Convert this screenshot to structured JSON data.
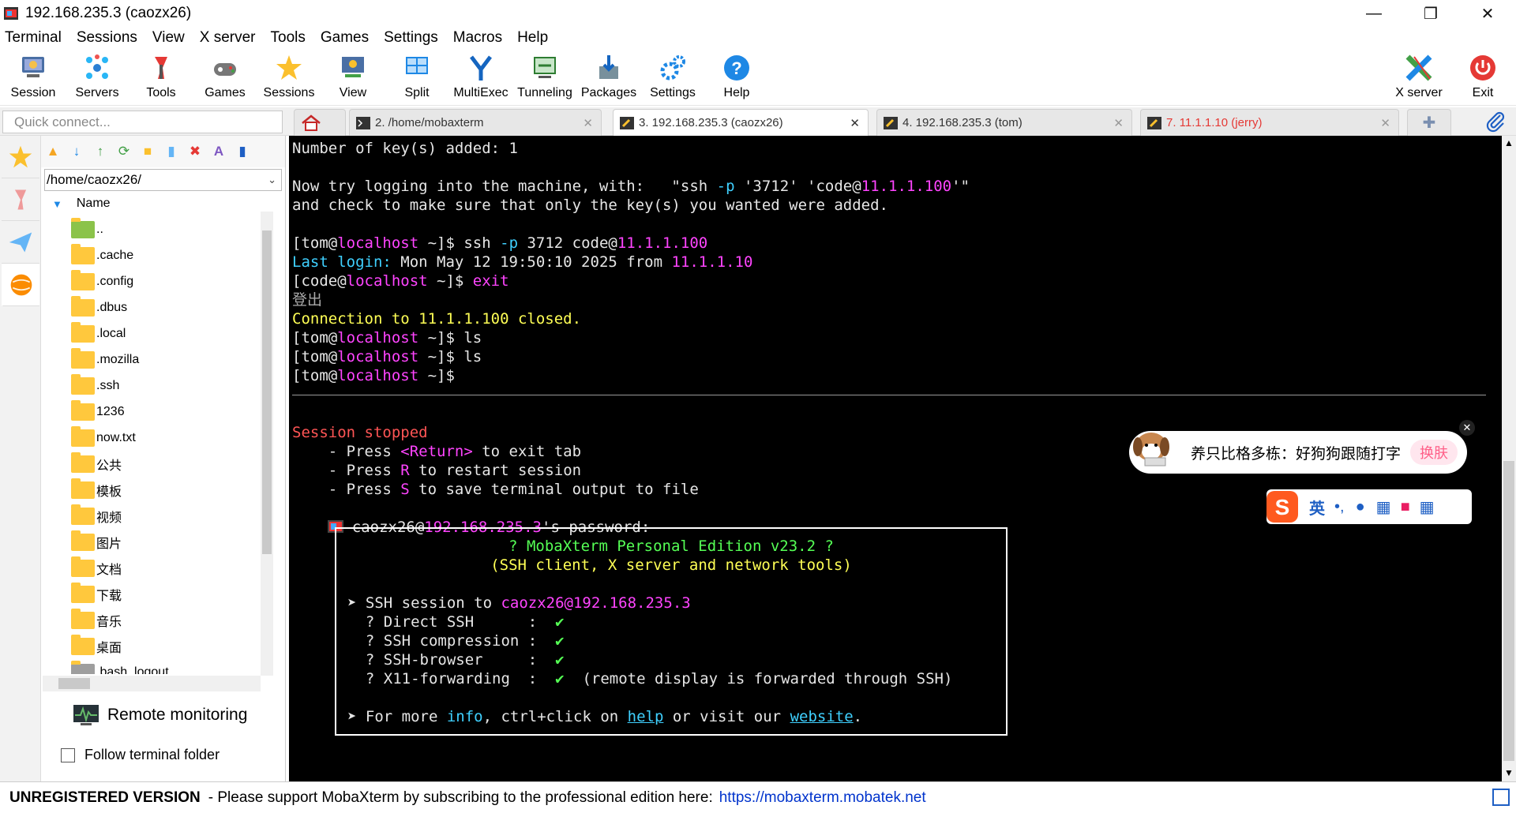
{
  "window": {
    "title": "192.168.235.3 (caozx26)",
    "minimize": "—",
    "maximize": "❐",
    "close": "✕"
  },
  "menu": [
    "Terminal",
    "Sessions",
    "View",
    "X server",
    "Tools",
    "Games",
    "Settings",
    "Macros",
    "Help"
  ],
  "toolbar": {
    "session": "Session",
    "servers": "Servers",
    "tools": "Tools",
    "games": "Games",
    "sessions": "Sessions",
    "view": "View",
    "split": "Split",
    "multiexec": "MultiExec",
    "tunneling": "Tunneling",
    "packages": "Packages",
    "settings": "Settings",
    "help": "Help",
    "xserver": "X server",
    "exit": "Exit"
  },
  "quick_connect": {
    "placeholder": "Quick connect..."
  },
  "tabs": [
    {
      "label": "2. /home/mobaxterm"
    },
    {
      "label": "3. 192.168.235.3 (caozx26)"
    },
    {
      "label": "4. 192.168.235.3 (tom)"
    },
    {
      "label": "7. 11.1.1.10 (jerry)"
    }
  ],
  "file_panel": {
    "path": "/home/caozx26/",
    "column": "Name",
    "entries": [
      "..",
      ".cache",
      ".config",
      ".dbus",
      ".local",
      ".mozilla",
      ".ssh",
      "1236",
      "now.txt",
      "公共",
      "模板",
      "视频",
      "图片",
      "文档",
      "下载",
      "音乐",
      "桌面",
      ".bash_logout"
    ],
    "remote_monitoring": "Remote monitoring",
    "follow_folder": "Follow terminal folder"
  },
  "terminal": {
    "l1": "Number of key(s) added: 1",
    "l2a": "Now try logging into the machine, with:   \"ssh ",
    "l2b": "-p",
    "l2c": " '3712' 'code@",
    "l2d": "11.1.1.100",
    "l2e": "'\"",
    "l3": "and check to make sure that only the key(s) you wanted were added.",
    "p_open": "[tom@",
    "p_host": "localhost",
    "p_close": " ~]$ ",
    "cmd1a": "ssh ",
    "cmd1b": "-p",
    "cmd1c": " 3712 code@",
    "cmd1d": "11.1.1.100",
    "last_login_label": "Last login:",
    "last_login_text": " Mon May 12 19:50:10 2025 from ",
    "last_login_ip": "11.1.1.10",
    "code_open": "[code@",
    "exit_cmd": "exit",
    "logout": "登出",
    "closed_a": "Connection to ",
    "closed_b": "11.1.1.100",
    "closed_c": " closed.",
    "ls": "ls",
    "stopped": "Session stopped",
    "press": "    - Press ",
    "key_return": "<Return>",
    "exit_tab": " to exit tab",
    "key_r": "R",
    "restart": " to restart session",
    "key_s": "S",
    "save": " to save terminal output to file",
    "pw_a": "caozx26@",
    "pw_b": "192.168.235.3",
    "pw_c": "'s password:",
    "box_title": "? MobaXterm Personal Edition v23.2 ?",
    "box_sub": "(SSH client, X server and network tools)",
    "ssh_a": "➤ SSH session to ",
    "ssh_b": "caozx26",
    "ssh_c": "@192.168.235.3",
    "direct": "  ? Direct SSH      :  ",
    "compression": "  ? SSH compression :  ",
    "browser": "  ? SSH-browser     :  ",
    "x11": "  ? X11-forwarding  :  ",
    "check": "✔",
    "x11_note": "  (remote display is forwarded through SSH)",
    "more_a": "➤ For more ",
    "more_info": "info",
    "more_b": ", ctrl+click on ",
    "more_help": "help",
    "more_c": " or visit our ",
    "more_website": "website",
    "more_d": "."
  },
  "ime": {
    "popup_text": "养只比格多栋：好狗狗跟随打字",
    "skin": "换肤",
    "lang": "英"
  },
  "status": {
    "unregistered": "UNREGISTERED VERSION",
    "message": " -  Please support MobaXterm by subscribing to the professional edition here:",
    "url": "https://mobaxterm.mobatek.net"
  },
  "colors": {
    "terminal_bg": "#000000",
    "prompt_host": "#ff44ff",
    "accent_cyan": "#3fd0ff",
    "warning_yellow": "#ffff55",
    "error_red": "#ff5555"
  }
}
